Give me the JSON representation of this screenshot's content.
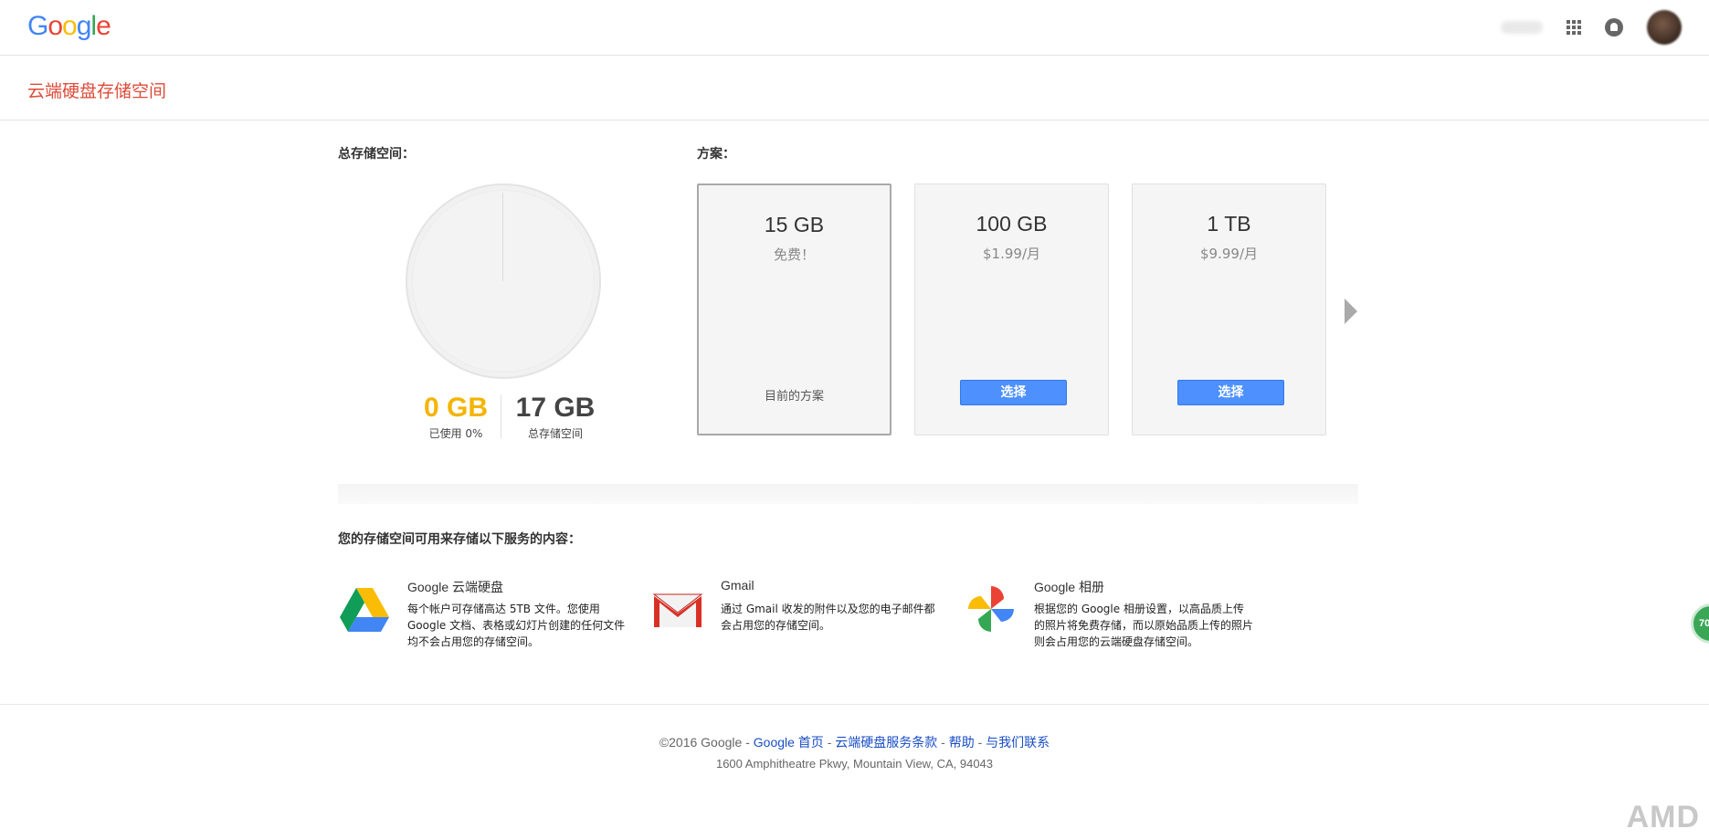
{
  "header": {
    "logo_letters": [
      {
        "ch": "G",
        "color": "#4285f4"
      },
      {
        "ch": "o",
        "color": "#ea4335"
      },
      {
        "ch": "o",
        "color": "#fbbc05"
      },
      {
        "ch": "g",
        "color": "#4285f4"
      },
      {
        "ch": "l",
        "color": "#34a853"
      },
      {
        "ch": "e",
        "color": "#ea4335"
      }
    ],
    "icons": [
      "apps-grid-icon",
      "notifications-bell-icon",
      "avatar"
    ]
  },
  "page_title": "云端硬盘存储空间",
  "storage": {
    "label": "总存储空间：",
    "used_value": "0 GB",
    "used_caption": "已使用 0%",
    "used_fraction": 0,
    "total_value": "17 GB",
    "total_caption": "总存储空间"
  },
  "plans": {
    "label": "方案：",
    "items": [
      {
        "size": "15 GB",
        "price": "免费！",
        "current_label": "目前的方案"
      },
      {
        "size": "100 GB",
        "price": "$1.99/月",
        "button": "选择"
      },
      {
        "size": "1 TB",
        "price": "$9.99/月",
        "button": "选择"
      }
    ]
  },
  "services": {
    "label": "您的存储空间可用来存储以下服务的内容：",
    "items": [
      {
        "title": "Google 云端硬盘",
        "desc": "每个帐户可存储高达 5TB 文件。您使用 Google 文档、表格或幻灯片创建的任何文件均不会占用您的存储空间。",
        "icon": "google-drive-icon"
      },
      {
        "title": "Gmail",
        "desc": "通过 Gmail 收发的附件以及您的电子邮件都会占用您的存储空间。",
        "icon": "gmail-icon"
      },
      {
        "title": "Google 相册",
        "desc": "根据您的 Google 相册设置，以高品质上传的照片将免费存储，而以原始品质上传的照片则会占用您的云端硬盘存储空间。",
        "icon": "google-photos-icon"
      }
    ]
  },
  "footer": {
    "copyright": "©2016 Google",
    "sep": " - ",
    "links": [
      "Google 首页",
      "云端硬盘服务条款",
      "帮助",
      "与我们联系"
    ],
    "address": "1600 Amphitheatre Pkwy, Mountain View, CA, 94043"
  },
  "badge_text": "70",
  "watermark": "AMD"
}
